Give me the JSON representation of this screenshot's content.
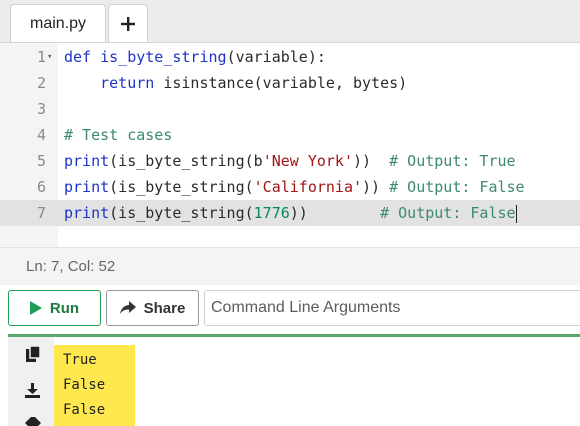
{
  "tabs": {
    "file_label": "main.py",
    "add_label": "+"
  },
  "editor": {
    "lines": [
      {
        "num": "1",
        "tokens": [
          {
            "t": "def",
            "c": "kw"
          },
          {
            "t": " ",
            "c": ""
          },
          {
            "t": "is_byte_string",
            "c": "fn"
          },
          {
            "t": "(variable):",
            "c": ""
          }
        ]
      },
      {
        "num": "2",
        "tokens": [
          {
            "t": "    ",
            "c": ""
          },
          {
            "t": "return",
            "c": "kw"
          },
          {
            "t": " isinstance(variable, bytes)",
            "c": ""
          }
        ]
      },
      {
        "num": "3",
        "tokens": []
      },
      {
        "num": "4",
        "tokens": [
          {
            "t": "# Test cases",
            "c": "cm"
          }
        ]
      },
      {
        "num": "5",
        "tokens": [
          {
            "t": "print",
            "c": "fn"
          },
          {
            "t": "(is_byte_string(b",
            "c": ""
          },
          {
            "t": "'New York'",
            "c": "str"
          },
          {
            "t": "))  ",
            "c": ""
          },
          {
            "t": "# Output: True",
            "c": "cm"
          }
        ]
      },
      {
        "num": "6",
        "tokens": [
          {
            "t": "print",
            "c": "fn"
          },
          {
            "t": "(is_byte_string(",
            "c": ""
          },
          {
            "t": "'California'",
            "c": "str"
          },
          {
            "t": ")) ",
            "c": ""
          },
          {
            "t": "# Output: False",
            "c": "cm"
          }
        ]
      },
      {
        "num": "7",
        "tokens": [
          {
            "t": "print",
            "c": "fn"
          },
          {
            "t": "(is_byte_string(",
            "c": ""
          },
          {
            "t": "1776",
            "c": "num"
          },
          {
            "t": "))        ",
            "c": ""
          },
          {
            "t": "# Output: False",
            "c": "cm"
          }
        ]
      }
    ],
    "cursor_position": "Ln: 7,  Col: 52"
  },
  "toolbar": {
    "run_label": "Run",
    "share_label": "Share",
    "args_placeholder": "Command Line Arguments"
  },
  "output": {
    "lines": [
      "True",
      "False",
      "False"
    ]
  },
  "icons": {
    "run": "play-icon",
    "share": "share-arrow-icon",
    "copy": "copy-icon",
    "download": "download-icon",
    "clear": "eraser-icon"
  },
  "colors": {
    "run_accent": "#1f9d55",
    "output_highlight": "#ffe84d",
    "keyword": "#1d33c9",
    "string": "#a31515",
    "number": "#098658",
    "comment": "#3d8a6a"
  }
}
